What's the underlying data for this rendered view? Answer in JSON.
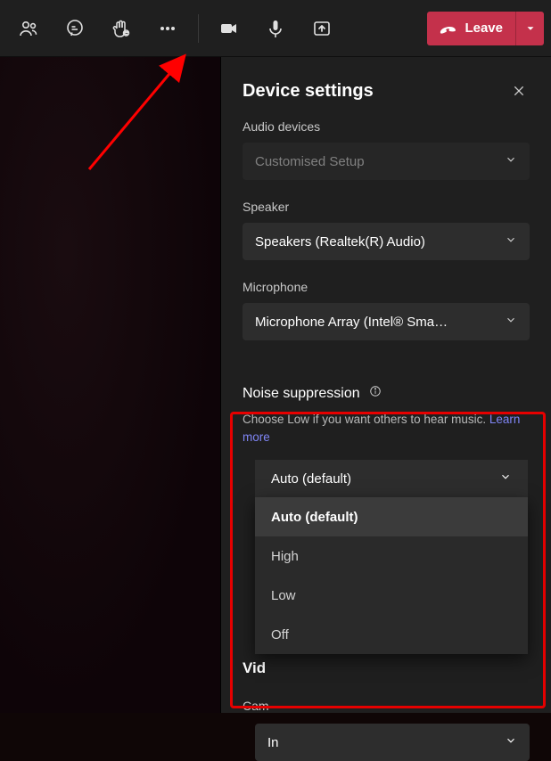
{
  "toolbar": {
    "leave_label": "Leave"
  },
  "panel": {
    "title": "Device settings",
    "audio_devices_label": "Audio devices",
    "audio_devices_value": "Customised Setup",
    "speaker_label": "Speaker",
    "speaker_value": "Speakers (Realtek(R) Audio)",
    "microphone_label": "Microphone",
    "microphone_value": "Microphone Array (Intel® Sma…"
  },
  "noise_suppression": {
    "title": "Noise suppression",
    "description": "Choose Low if you want others to hear music. ",
    "learn_more": "Learn more",
    "selected": "Auto (default)",
    "options": [
      "Auto (default)",
      "High",
      "Low",
      "Off"
    ]
  },
  "video_section": {
    "title_partial": "Vid",
    "camera_label_partial": "Cam",
    "camera_value_partial": "In"
  }
}
